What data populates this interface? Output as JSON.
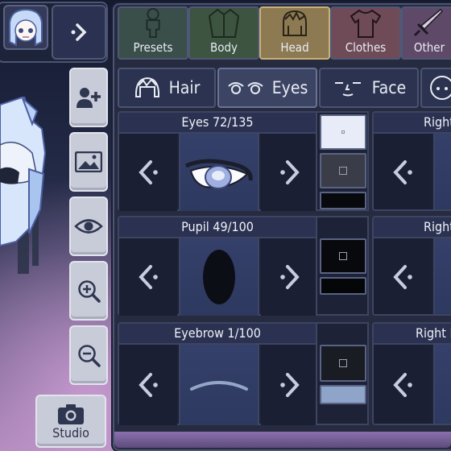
{
  "colors": {
    "active_tab": "#8d7a52",
    "panel_bg": "#262b40",
    "button_light": "#c8cbd8"
  },
  "top": {
    "avatar_icon": "character-head-icon",
    "arrow_icon": "chevron-right-icon"
  },
  "side_buttons": [
    {
      "name": "add-character-button",
      "icon": "add-person-icon"
    },
    {
      "name": "background-button",
      "icon": "image-icon"
    },
    {
      "name": "toggle-view-button",
      "icon": "eye-icon"
    },
    {
      "name": "zoom-in-button",
      "icon": "zoom-in-icon"
    },
    {
      "name": "zoom-out-button",
      "icon": "zoom-out-icon"
    }
  ],
  "studio": {
    "label": "Studio",
    "icon": "camera-icon"
  },
  "categories": [
    {
      "label": "Presets",
      "icon": "person-silhouette-icon"
    },
    {
      "label": "Body",
      "icon": "jacket-icon"
    },
    {
      "label": "Head",
      "icon": "head-icon",
      "active": true
    },
    {
      "label": "Clothes",
      "icon": "shirt-icon"
    },
    {
      "label": "Other",
      "icon": "sword-icon"
    }
  ],
  "subtabs": [
    {
      "label": "Hair",
      "icon": "hair-icon"
    },
    {
      "label": "Eyes",
      "icon": "eyes-icon",
      "active": true
    },
    {
      "label": "Face",
      "icon": "face-icon"
    },
    {
      "label": "",
      "icon": "head-outline-icon"
    }
  ],
  "cards": [
    {
      "title": "Eyes 72/135"
    },
    {
      "title": "Pupil 49/100"
    },
    {
      "title": "Eyebrow 1/100"
    }
  ],
  "right_cards": [
    {
      "title": "Right"
    },
    {
      "title": "Right"
    },
    {
      "title": "Right E"
    }
  ]
}
